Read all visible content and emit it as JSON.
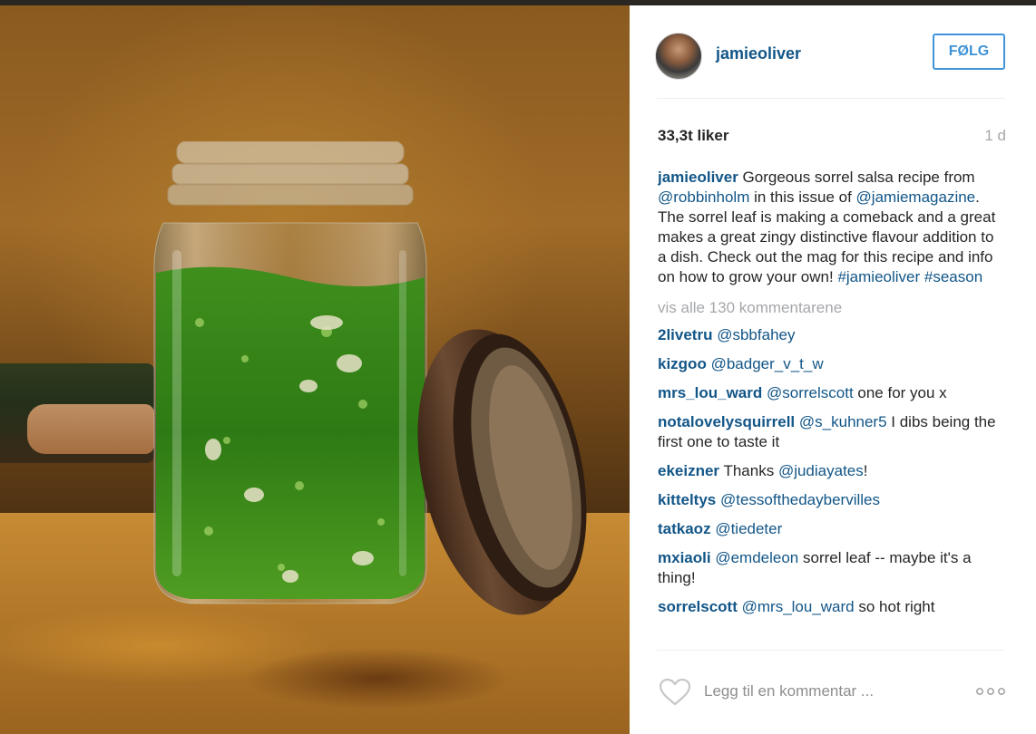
{
  "post": {
    "username": "jamieoliver",
    "follow_label": "FØLG",
    "likes": "33,3t liker",
    "time": "1 d",
    "caption": {
      "user": "jamieoliver",
      "t1": " Gorgeous sorrel salsa recipe from ",
      "m1": "@robbinholm",
      "t2": " in this issue of ",
      "m2": "@jamiemagazine",
      "t3": ". The sorrel leaf is making a comeback and a great makes a great zingy distinctive flavour addition to a dish. Check out the mag for this recipe and info on how to grow your own! ",
      "h1": "#jamieoliver",
      "t4": " ",
      "h2": "#season"
    },
    "view_all": "vis alle 130 kommentarene",
    "comments": [
      {
        "user": "2livetru",
        "pre": " ",
        "mention": "@sbbfahey",
        "post": ""
      },
      {
        "user": "kizgoo",
        "pre": " ",
        "mention": "@badger_v_t_w",
        "post": ""
      },
      {
        "user": "mrs_lou_ward",
        "pre": " ",
        "mention": "@sorrelscott",
        "post": " one for you x"
      },
      {
        "user": "notalovelysquirrell",
        "pre": " ",
        "mention": "@s_kuhner5",
        "post": " I dibs being the first one to taste it"
      },
      {
        "user": "ekeizner",
        "pre": " Thanks ",
        "mention": "@judiayates",
        "post": "!"
      },
      {
        "user": "kitteltys",
        "pre": " ",
        "mention": "@tessofthedaybervilles",
        "post": ""
      },
      {
        "user": "tatkaoz",
        "pre": " ",
        "mention": "@tiedeter",
        "post": ""
      },
      {
        "user": "mxiaoli",
        "pre": " ",
        "mention": "@emdeleon",
        "post": " sorrel leaf -- maybe it's a thing!"
      },
      {
        "user": "sorrelscott",
        "pre": " ",
        "mention": "@mrs_lou_ward",
        "post": " so hot right"
      }
    ],
    "add_comment_placeholder": "Legg til en kommentar ...",
    "icons": {
      "like": "heart-outline-icon",
      "more": "more-dots-icon"
    },
    "colors": {
      "link": "#125688",
      "follow": "#3f93d6",
      "muted": "#a5a7aa"
    }
  }
}
